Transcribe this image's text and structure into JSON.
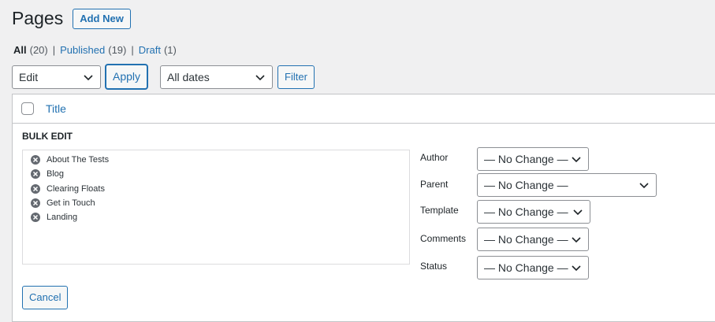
{
  "header": {
    "title": "Pages",
    "add_new_label": "Add New"
  },
  "views": [
    {
      "label": "All",
      "count": "(20)"
    },
    {
      "label": "Published",
      "count": "(19)"
    },
    {
      "label": "Draft",
      "count": "(1)"
    }
  ],
  "tablenav": {
    "bulk_action_value": "Edit",
    "apply_label": "Apply",
    "dates_value": "All dates",
    "filter_label": "Filter"
  },
  "table": {
    "title_column": "Title"
  },
  "bulk_edit": {
    "heading": "BULK EDIT",
    "titles": [
      "About The Tests",
      "Blog",
      "Clearing Floats",
      "Get in Touch",
      "Landing"
    ],
    "fields": [
      {
        "label": "Author",
        "value": "— No Change —"
      },
      {
        "label": "Parent",
        "value": "— No Change —"
      },
      {
        "label": "Template",
        "value": "— No Change —"
      },
      {
        "label": "Comments",
        "value": "— No Change —"
      },
      {
        "label": "Status",
        "value": "— No Change —"
      }
    ],
    "cancel_label": "Cancel"
  },
  "colors": {
    "accent": "#2271b1",
    "background": "#f0f0f1",
    "text": "#1d2327"
  }
}
